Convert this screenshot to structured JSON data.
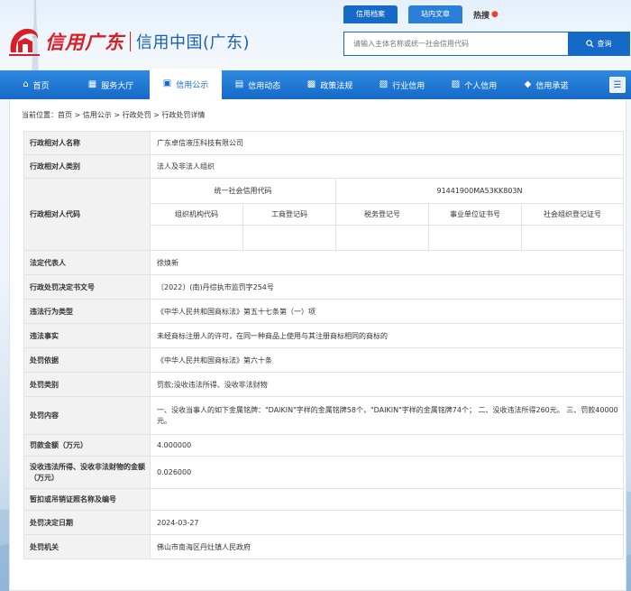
{
  "header": {
    "logo_text": "信用广东",
    "site_name": "信用中国(广东)",
    "search_tabs": [
      "信用档案",
      "站内文章"
    ],
    "hot_label": "热搜",
    "search_placeholder": "请输入主体名称或统一社会信用代码",
    "search_button": "查询"
  },
  "nav": {
    "items": [
      {
        "label": "首页",
        "icon": "home-icon"
      },
      {
        "label": "服务大厅",
        "icon": "grid-icon"
      },
      {
        "label": "信用公示",
        "icon": "briefcase-icon"
      },
      {
        "label": "信用动态",
        "icon": "document-icon"
      },
      {
        "label": "政策法规",
        "icon": "book-icon"
      },
      {
        "label": "行业信用",
        "icon": "building-icon"
      },
      {
        "label": "个人信用",
        "icon": "id-card-icon"
      },
      {
        "label": "信用承诺",
        "icon": "shield-icon"
      }
    ],
    "active_index": 2,
    "more_icon": "menu-icon"
  },
  "breadcrumb": [
    "当前位置：首页",
    "信用公示",
    "行政处罚",
    "行政处罚详情"
  ],
  "detail": {
    "party_name_label": "行政相对人名称",
    "party_name": "广东卓信液压科技有限公司",
    "party_type_label": "行政相对人类别",
    "party_type": "法人及非法人组织",
    "party_code_label": "行政相对人代码",
    "uscc_label": "统一社会信用代码",
    "uscc_value": "91441900MA53KK803N",
    "code_columns": [
      "组织机构代码",
      "工商登记码",
      "税务登记号",
      "事业单位证书号",
      "社会组织登记证号"
    ],
    "legal_rep_label": "法定代表人",
    "legal_rep": "徐焕新",
    "decision_no_label": "行政处罚决定书文号",
    "decision_no": "〔2022〕(南)丹综执市监罚字254号",
    "violation_type_label": "违法行为类型",
    "violation_type": "《中华人民共和国商标法》第五十七条第（一）项",
    "facts_label": "违法事实",
    "facts": "未经商标注册人的许可，在同一种商品上使用与其注册商标相同的商标的",
    "basis_label": "处罚依据",
    "basis": "《中华人民共和国商标法》第六十条",
    "category_label": "处罚类别",
    "category": "罚款;没收违法所得、没收非法财物",
    "content_label": "处罚内容",
    "content": "一、没收当事人的如下金属铭牌：\"DAIKIN\"字样的金属铭牌58个，\"DAIKIN\"字样的金属铭牌74个；  二、没收违法所得260元。 三、罚款40000元。",
    "fine_label": "罚款金额（万元）",
    "fine": "4.000000",
    "confiscation_label": "没收违法所得、没收非法财物的金额（万元）",
    "confiscation": "0.026000",
    "license_label": "暂扣或吊销证照名称及编号",
    "license": "",
    "date_label": "处罚决定日期",
    "date": "2024-03-27",
    "authority_label": "处罚机关",
    "authority": "佛山市南海区丹灶镇人民政府"
  }
}
